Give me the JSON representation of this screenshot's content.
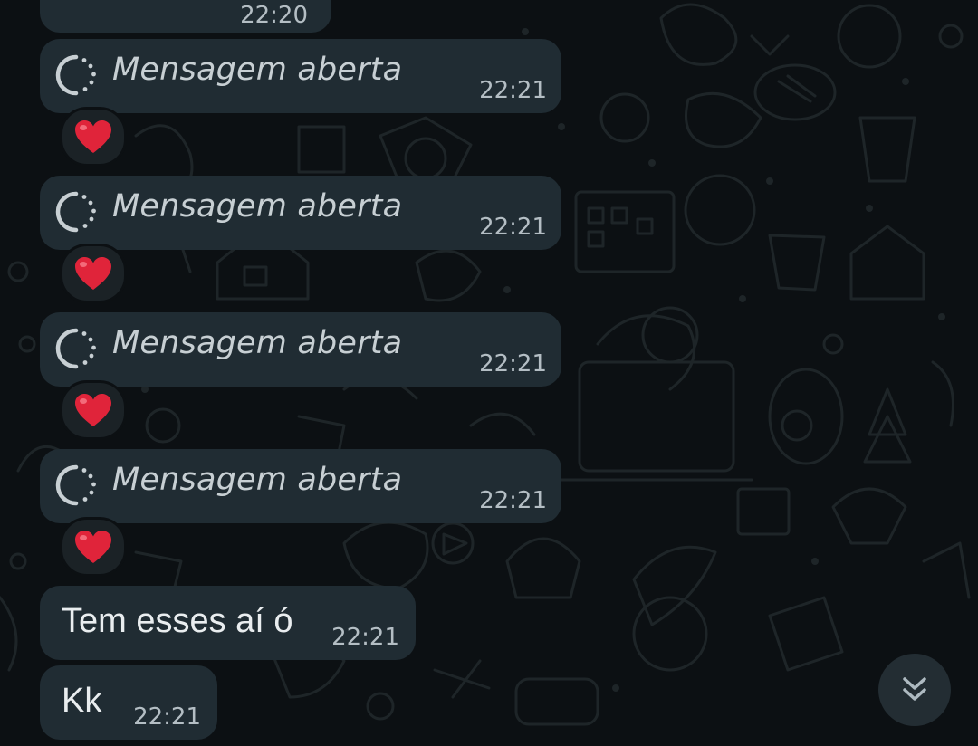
{
  "chat": {
    "top_partial_message": {
      "time": "22:20"
    },
    "view_once_messages": [
      {
        "text": "Mensagem aberta",
        "time": "22:21",
        "reaction": "red-heart"
      },
      {
        "text": "Mensagem aberta",
        "time": "22:21",
        "reaction": "red-heart"
      },
      {
        "text": "Mensagem aberta",
        "time": "22:21",
        "reaction": "red-heart"
      },
      {
        "text": "Mensagem aberta",
        "time": "22:21",
        "reaction": "red-heart"
      }
    ],
    "text_messages": [
      {
        "text": "Tem esses aí ó",
        "time": "22:21"
      },
      {
        "text": "Kk",
        "time": "22:21"
      }
    ],
    "scroll_to_bottom_icon": "double-chevron-down-icon"
  },
  "colors": {
    "background": "#0c1013",
    "bubble": "#202c33",
    "text": "#e9edef",
    "time": "#b4bec4",
    "heart": "#e0243a"
  }
}
